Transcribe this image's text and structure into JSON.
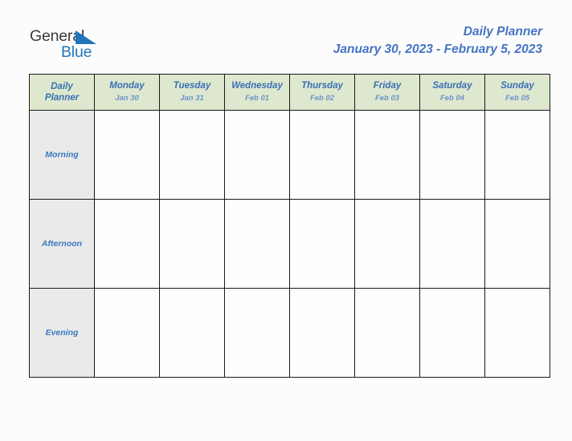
{
  "logo": {
    "word_dark": "General",
    "word_blue": "Blue",
    "triangle_icon": "triangle-icon",
    "dark_color": "#3b3b3b",
    "blue_color": "#1f76bd"
  },
  "header": {
    "title": "Daily Planner",
    "date_range": "January 30, 2023 - February 5, 2023",
    "title_color": "#4573c4"
  },
  "table": {
    "corner_label_line1": "Daily",
    "corner_label_line2": "Planner",
    "header_bg": "#dde8ce",
    "row_label_bg": "#eaeaea",
    "cell_bg": "#fdfdfd",
    "border_color": "#1a1a1a",
    "day_name_color": "#3a6fb5",
    "day_date_color": "#6e93c9",
    "row_label_color": "#3a78c2",
    "columns": [
      {
        "day": "Monday",
        "date": "Jan 30"
      },
      {
        "day": "Tuesday",
        "date": "Jan 31"
      },
      {
        "day": "Wednesday",
        "date": "Feb 01"
      },
      {
        "day": "Thursday",
        "date": "Feb 02"
      },
      {
        "day": "Friday",
        "date": "Feb 03"
      },
      {
        "day": "Saturday",
        "date": "Feb 04"
      },
      {
        "day": "Sunday",
        "date": "Feb 05"
      }
    ],
    "rows": [
      {
        "label": "Morning",
        "cells": [
          "",
          "",
          "",
          "",
          "",
          "",
          ""
        ]
      },
      {
        "label": "Afternoon",
        "cells": [
          "",
          "",
          "",
          "",
          "",
          "",
          ""
        ]
      },
      {
        "label": "Evening",
        "cells": [
          "",
          "",
          "",
          "",
          "",
          "",
          ""
        ]
      }
    ]
  }
}
